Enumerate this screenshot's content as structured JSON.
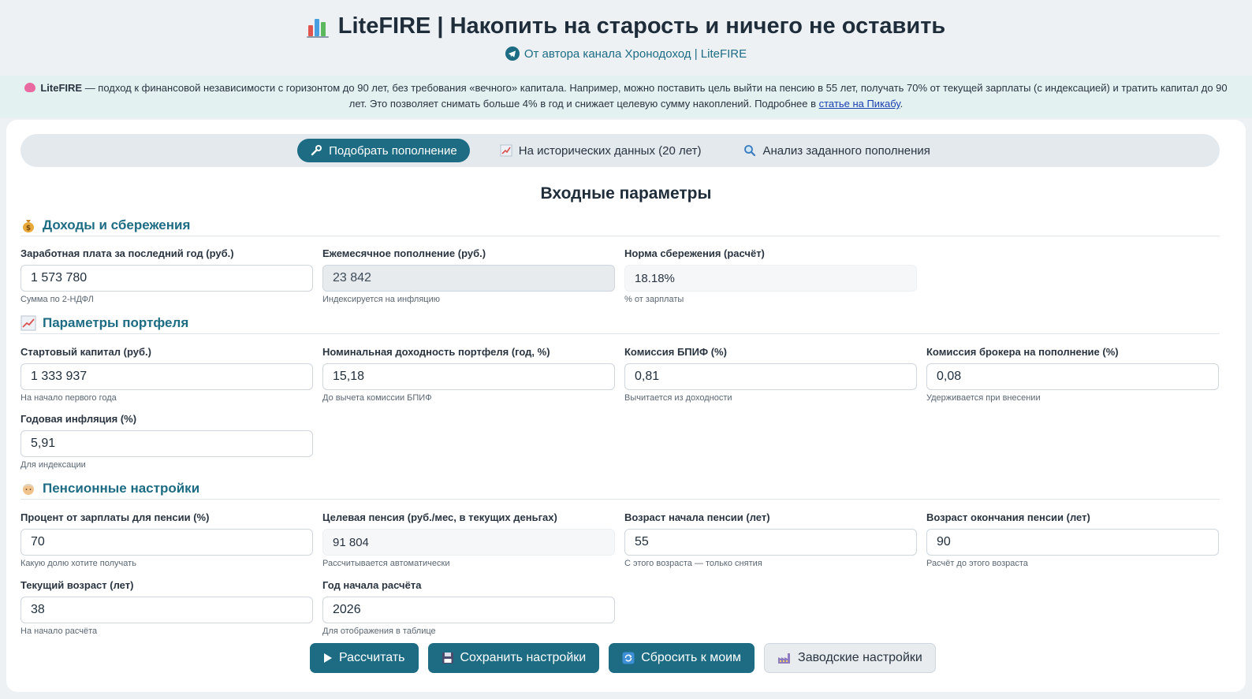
{
  "header": {
    "title": "LiteFIRE | Накопить на старость и ничего не оставить",
    "subtitle": "От автора канала Хронодоход | LiteFIRE"
  },
  "banner": {
    "brand": "LiteFIRE",
    "text": " — подход к финансовой независимости с горизонтом до 90 лет, без требования «вечного» капитала. Например, можно поставить цель выйти на пенсию в 55 лет, получать 70% от текущей зарплаты (с индексацией) и тратить капитал до 90 лет. Это позволяет снимать больше 4% в год и снижает целевую сумму накоплений. Подробнее в ",
    "link": "статье на Пикабу",
    "end": "."
  },
  "tabs": [
    {
      "label": "Подобрать пополнение",
      "icon": "wrench-icon"
    },
    {
      "label": "На исторических данных (20 лет)",
      "icon": "chart-up-icon"
    },
    {
      "label": "Анализ заданного пополнения",
      "icon": "magnifier-icon"
    }
  ],
  "main_title": "Входные параметры",
  "sections": {
    "income": {
      "title": "Доходы и сбережения",
      "icon": "money-bag-icon"
    },
    "portfolio": {
      "title": "Параметры портфеля",
      "icon": "chart-up-icon"
    },
    "pension": {
      "title": "Пенсионные настройки",
      "icon": "elder-icon"
    }
  },
  "fields": {
    "salary": {
      "label": "Заработная плата за последний год (руб.)",
      "value": "1 573 780",
      "hint": "Сумма по 2-НДФЛ"
    },
    "monthly": {
      "label": "Ежемесячное пополнение (руб.)",
      "value": "23 842",
      "hint": "Индексируется на инфляцию"
    },
    "savings_rate": {
      "label": "Норма сбережения (расчёт)",
      "value": "18.18%",
      "hint": "% от зарплаты"
    },
    "start_capital": {
      "label": "Стартовый капитал (руб.)",
      "value": "1 333 937",
      "hint": "На начало первого года"
    },
    "nominal_return": {
      "label": "Номинальная доходность портфеля (год, %)",
      "value": "15,18",
      "hint": "До вычета комиссии БПИФ"
    },
    "fund_fee": {
      "label": "Комиссия БПИФ (%)",
      "value": "0,81",
      "hint": "Вычитается из доходности"
    },
    "broker_fee": {
      "label": "Комиссия брокера на пополнение (%)",
      "value": "0,08",
      "hint": "Удерживается при внесении"
    },
    "inflation": {
      "label": "Годовая инфляция (%)",
      "value": "5,91",
      "hint": "Для индексации"
    },
    "pension_percent": {
      "label": "Процент от зарплаты для пенсии (%)",
      "value": "70",
      "hint": "Какую долю хотите получать"
    },
    "target_pension": {
      "label": "Целевая пенсия (руб./мес, в текущих деньгах)",
      "value": "91 804",
      "hint": "Рассчитывается автоматически"
    },
    "pension_start_age": {
      "label": "Возраст начала пенсии (лет)",
      "value": "55",
      "hint": "С этого возраста — только снятия"
    },
    "pension_end_age": {
      "label": "Возраст окончания пенсии (лет)",
      "value": "90",
      "hint": "Расчёт до этого возраста"
    },
    "current_age": {
      "label": "Текущий возраст (лет)",
      "value": "38",
      "hint": "На начало расчёта"
    },
    "start_year": {
      "label": "Год начала расчёта",
      "value": "2026",
      "hint": "Для отображения в таблице"
    }
  },
  "buttons": {
    "calculate": "Рассчитать",
    "save": "Сохранить настройки",
    "reset_mine": "Сбросить к моим",
    "factory": "Заводские настройки"
  },
  "colors": {
    "accent": "#1d6c84",
    "background": "#edf1f4",
    "banner": "#e3f1f1"
  }
}
